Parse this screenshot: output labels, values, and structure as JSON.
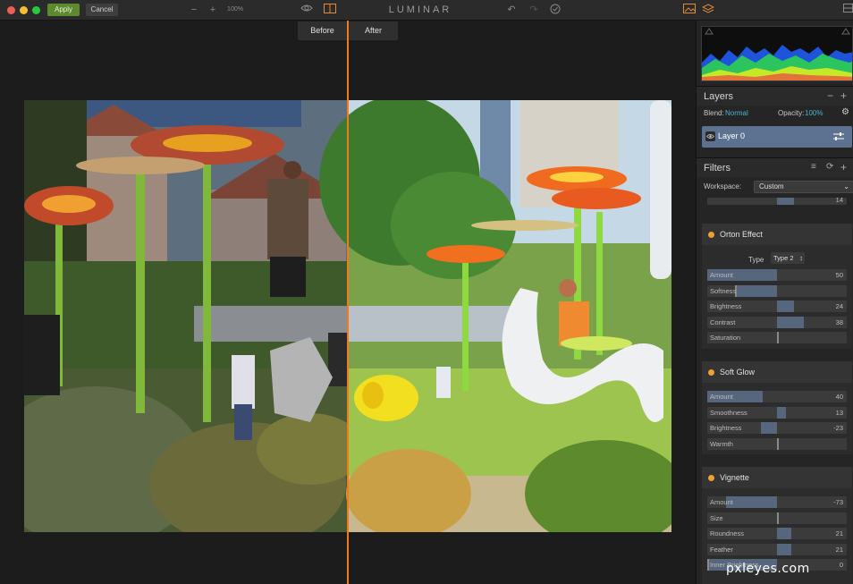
{
  "toolbar": {
    "apply_label": "Apply",
    "cancel_label": "Cancel",
    "zoom_minus": "−",
    "zoom_plus": "+",
    "zoom_level": "100%",
    "app_title": "LUMINAR",
    "eye_icon": "eye-icon",
    "compare_icon": "split-compare-icon",
    "undo_icon": "undo-icon",
    "redo_icon": "redo-icon",
    "history_icon": "history-icon",
    "photo_icon": "image-icon",
    "layers_icon": "layers-icon",
    "window_icon": "panel-toggle-icon"
  },
  "compare": {
    "before_label": "Before",
    "after_label": "After"
  },
  "layers": {
    "title": "Layers",
    "blend_label": "Blend:",
    "blend_value": "Normal",
    "opacity_label": "Opacity:",
    "opacity_value": "100%",
    "layer_name": "Layer 0"
  },
  "filters": {
    "title": "Filters",
    "workspace_label": "Workspace:",
    "workspace_value": "Custom",
    "partial_row_value": "14",
    "orton": {
      "name": "Orton Effect",
      "type_label": "Type",
      "type_value": "Type 2",
      "sliders": [
        {
          "label": "Amount",
          "value": "50",
          "fraction": 0.5
        },
        {
          "label": "Softness",
          "value": "",
          "fraction": 0.2
        },
        {
          "label": "Brightness",
          "value": "24",
          "fraction": 0.62
        },
        {
          "label": "Contrast",
          "value": "38",
          "fraction": 0.69
        },
        {
          "label": "Saturation",
          "value": "",
          "fraction": 0.5
        }
      ]
    },
    "softglow": {
      "name": "Soft Glow",
      "sliders": [
        {
          "label": "Amount",
          "value": "40",
          "fraction": 0.4
        },
        {
          "label": "Smoothness",
          "value": "13",
          "fraction": 0.565
        },
        {
          "label": "Brightness",
          "value": "-23",
          "fraction": 0.385
        },
        {
          "label": "Warmth",
          "value": "",
          "fraction": 0.5
        }
      ]
    },
    "vignette": {
      "name": "Vignette",
      "sliders": [
        {
          "label": "Amount",
          "value": "-73",
          "fraction": 0.135
        },
        {
          "label": "Size",
          "value": "",
          "fraction": 0.5
        },
        {
          "label": "Roundness",
          "value": "21",
          "fraction": 0.605
        },
        {
          "label": "Feather",
          "value": "21",
          "fraction": 0.605
        },
        {
          "label": "Inner Brightness",
          "value": "0",
          "fraction": 0.0
        }
      ]
    }
  },
  "watermark": "pxleyes.com",
  "colors": {
    "accent": "#f07a1e",
    "apply": "#5d8a2e",
    "layer_selected": "#5c7290",
    "slider_fill": "#56667c",
    "link": "#4ab3d8"
  }
}
